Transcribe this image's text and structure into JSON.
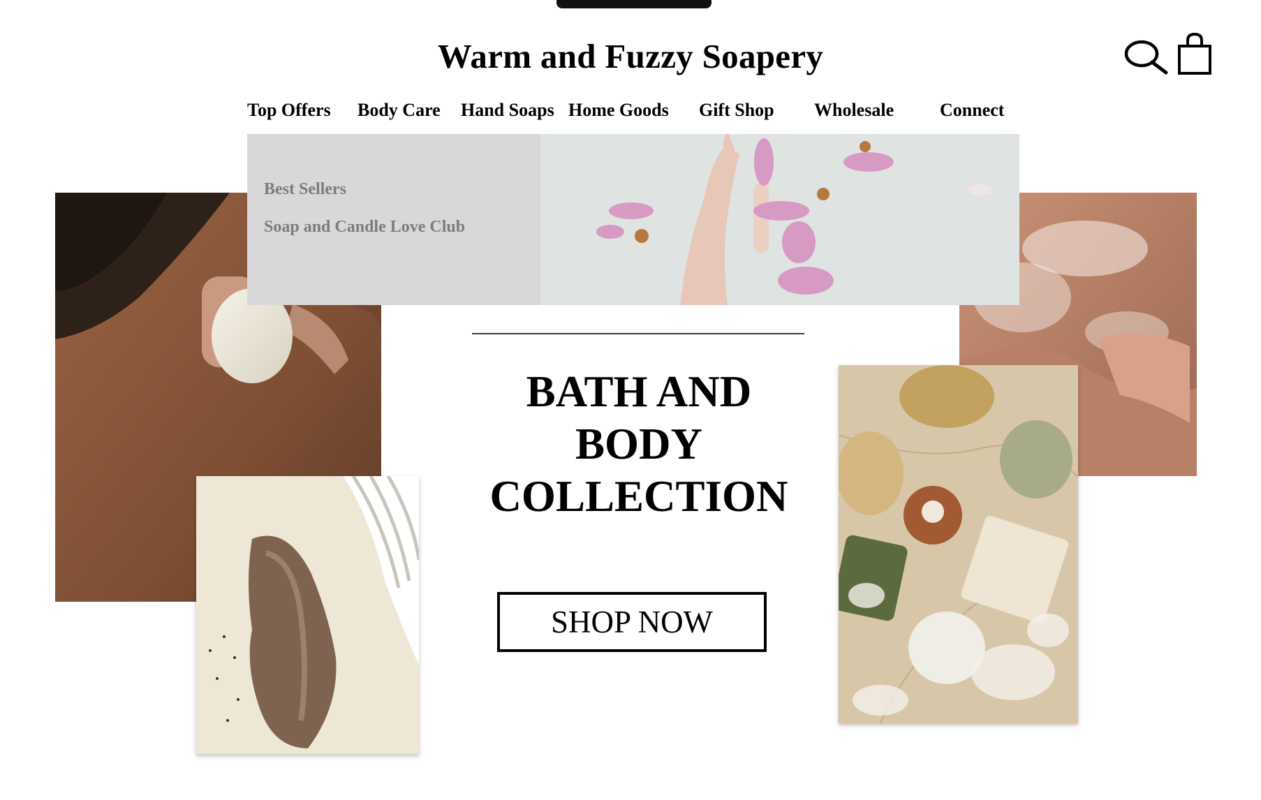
{
  "header": {
    "brand": "Warm and Fuzzy Soapery",
    "icons": {
      "search": "search-icon",
      "bag": "shopping-bag-icon"
    }
  },
  "nav": {
    "items": [
      "Top Offers",
      "Body Care",
      "Hand Soaps",
      "Home Goods",
      "Gift Shop",
      "Wholesale",
      "Connect"
    ]
  },
  "dropdown": {
    "links": [
      "Best Sellers",
      "Soap and Candle Love Club"
    ]
  },
  "hero": {
    "headline_lines": [
      "BATH AND",
      "BODY",
      "COLLECTION"
    ],
    "cta": "SHOP NOW"
  },
  "colors": {
    "text": "#000000",
    "dropdown_bg": "#d8d8d8",
    "dropdown_text": "#7c7c7c",
    "skin": "#8a5a3e"
  }
}
